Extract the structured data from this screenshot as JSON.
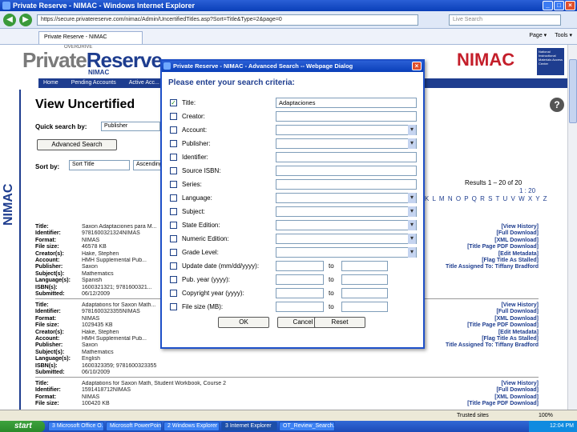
{
  "browser": {
    "title": "Private Reserve - NIMAC - Windows Internet Explorer",
    "address": "https://secure.privatereserve.com/nimac/Admin/UncertifiedTitles.asp?Sort=Title&Type=2&page=0",
    "search_placeholder": "Live Search",
    "tab_label": "Private Reserve - NIMAC",
    "tools": [
      "Page ▾",
      "Tools ▾"
    ]
  },
  "header": {
    "over": "OVERDRIVE",
    "brand_gray": "Private",
    "brand_blue": "Reserve",
    "brand_sub": "NIMAC",
    "nimac_logo": "NIMAC",
    "nimac_small": "National Instructional Materials Access Center",
    "nav": [
      "Home",
      "Pending Accounts",
      "Active Acc..."
    ],
    "side_logo": "NIMAC"
  },
  "main": {
    "title": "View Uncertified",
    "quick_search_label": "Quick search by:",
    "quick_search_value": "Publisher",
    "advanced_button": "Advanced Search",
    "sort_label": "Sort by:",
    "sort_value": "Sort Title",
    "sort_dir": "Ascending",
    "help": "?",
    "results": "Results 1 – 20 of 20",
    "pages": "1 : 20",
    "alphabet": "K L M N O P Q R S T U V W X Y Z"
  },
  "records": [
    {
      "fields": [
        {
          "k": "Title:",
          "v": "Saxon Adaptaciones para M..."
        },
        {
          "k": "Identifier:",
          "v": "9781600321324NIMAS"
        },
        {
          "k": "Format:",
          "v": "NIMAS"
        },
        {
          "k": "File size:",
          "v": "46578 KB"
        },
        {
          "k": "Creator(s):",
          "v": "Hake, Stephen"
        },
        {
          "k": "Account:",
          "v": "HMH Supplemental Pub..."
        },
        {
          "k": "Publisher:",
          "v": "Saxon"
        },
        {
          "k": "Subject(s):",
          "v": "Mathematics"
        },
        {
          "k": "Language(s):",
          "v": "Spanish"
        },
        {
          "k": "ISBN(s):",
          "v": "1600321321; 9781600321..."
        },
        {
          "k": "Submitted:",
          "v": "06/12/2009"
        }
      ],
      "links": [
        "[View History]",
        "[Full Download]",
        "[XML Download]",
        "[Title Page PDF Download]",
        "[Edit Metadata]",
        "[Flag Title As Stalled]",
        "Title Assigned To: Tiffany Bradford"
      ]
    },
    {
      "fields": [
        {
          "k": "Title:",
          "v": "Adaptations for Saxon Math..."
        },
        {
          "k": "Identifier:",
          "v": "9781600323355NIMAS"
        },
        {
          "k": "Format:",
          "v": "NIMAS"
        },
        {
          "k": "File size:",
          "v": "1029435 KB"
        },
        {
          "k": "Creator(s):",
          "v": "Hake, Stephen"
        },
        {
          "k": "Account:",
          "v": "HMH Supplemental Pub..."
        },
        {
          "k": "Publisher:",
          "v": "Saxon"
        },
        {
          "k": "Subject(s):",
          "v": "Mathematics"
        },
        {
          "k": "Language(s):",
          "v": "English"
        },
        {
          "k": "ISBN(s):",
          "v": "1600323359; 9781600323355"
        },
        {
          "k": "Submitted:",
          "v": "06/10/2009"
        }
      ],
      "links": [
        "[View History]",
        "[Full Download]",
        "[XML Download]",
        "[Title Page PDF Download]",
        "[Edit Metadata]",
        "[Flag Title As Stalled]",
        "Title Assigned To: Tiffany Bradford"
      ]
    },
    {
      "fields": [
        {
          "k": "Title:",
          "v": "Adaptations for Saxon Math, Student Workbook, Course 2"
        },
        {
          "k": "Identifier:",
          "v": "1591418712NIMAS"
        },
        {
          "k": "Format:",
          "v": "NIMAS"
        },
        {
          "k": "File size:",
          "v": "100420 KB"
        }
      ],
      "links": [
        "[View History]",
        "[Full Download]",
        "[XML Download]",
        "[Title Page PDF Download]"
      ]
    }
  ],
  "dialog": {
    "title": "Private Reserve - NIMAC - Advanced Search -- Webpage Dialog",
    "prompt": "Please enter your search criteria:",
    "criteria": [
      {
        "label": "Title:",
        "type": "text",
        "value": "Adaptaciones",
        "checked": true
      },
      {
        "label": "Creator:",
        "type": "text",
        "value": "",
        "checked": false
      },
      {
        "label": "Account:",
        "type": "select",
        "value": "",
        "checked": false
      },
      {
        "label": "Publisher:",
        "type": "select",
        "value": "",
        "checked": false
      },
      {
        "label": "Identifier:",
        "type": "text",
        "value": "",
        "checked": false
      },
      {
        "label": "Source ISBN:",
        "type": "text",
        "value": "",
        "checked": false
      },
      {
        "label": "Series:",
        "type": "text",
        "value": "",
        "checked": false
      },
      {
        "label": "Language:",
        "type": "select",
        "value": "",
        "checked": false
      },
      {
        "label": "Subject:",
        "type": "select",
        "value": "",
        "checked": false
      },
      {
        "label": "State Edition:",
        "type": "select",
        "value": "",
        "checked": false
      },
      {
        "label": "Numeric Edition:",
        "type": "select",
        "value": "",
        "checked": false
      },
      {
        "label": "Grade Level:",
        "type": "select",
        "value": "",
        "checked": false
      },
      {
        "label": "Update date (mm/dd/yyyy):",
        "type": "range",
        "value": "",
        "checked": false
      },
      {
        "label": "Pub. year (yyyy):",
        "type": "range",
        "value": "",
        "checked": false
      },
      {
        "label": "Copyright year (yyyy):",
        "type": "range",
        "value": "",
        "checked": false
      },
      {
        "label": "File size (MB):",
        "type": "range",
        "value": "",
        "checked": false
      }
    ],
    "to_label": "to",
    "ok": "OK",
    "cancel": "Cancel",
    "reset": "Reset"
  },
  "status": {
    "zone": "Trusted sites",
    "zoom": "100%"
  },
  "taskbar": {
    "start": "start",
    "tasks": [
      "3 Microsoft Office O...",
      "Microsoft PowerPoint...",
      "2 Windows Explorer",
      "3 Internet Explorer",
      "OT_Review_Search.p..."
    ],
    "clock": "12:04 PM"
  }
}
